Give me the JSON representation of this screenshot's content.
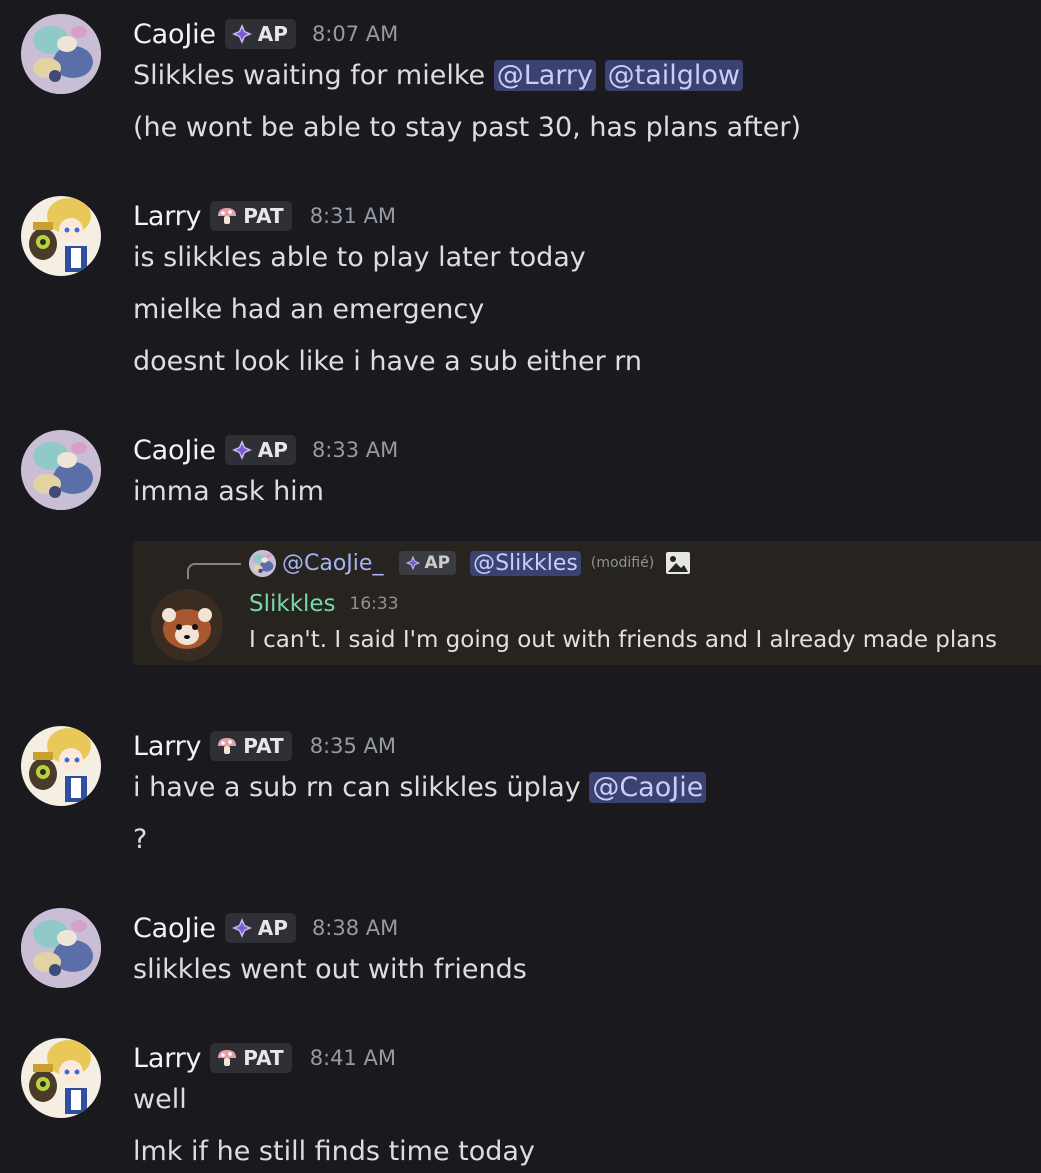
{
  "colors": {
    "background": "#1a1a1e",
    "mention_bg": "#3c4270",
    "mention_fg": "#c9cdfb",
    "quote_name": "#7ad7a9"
  },
  "tags": {
    "caojie": "AP",
    "larry": "PAT",
    "caojie_icon": "diamond-sparkle-icon",
    "larry_icon": "mushroom-icon"
  },
  "messages": [
    {
      "user": "CaoJie",
      "time": "8:07 AM",
      "line1_text": "Slikkles waiting for mielke ",
      "line1_mention1": "@Larry",
      "line1_mention2": "@tailglow",
      "line2": "(he wont be able to stay past 30, has plans after)"
    },
    {
      "user": "Larry",
      "time": "8:31 AM",
      "line1": "is slikkles able to play later today",
      "line2": "mielke had an emergency",
      "line3": "doesnt look like i have a sub either rn"
    },
    {
      "user": "CaoJie",
      "time": "8:33 AM",
      "line1": "imma ask him"
    },
    {
      "user": "Larry",
      "time": "8:35 AM",
      "line1_text": "i have a sub rn can slikkles üplay ",
      "line1_mention": "@CaoJie",
      "line2": "?"
    },
    {
      "user": "CaoJie",
      "time": "8:38 AM",
      "line1": "slikkles went out with friends"
    },
    {
      "user": "Larry",
      "time": "8:41 AM",
      "line1": "well",
      "line2": "lmk if he still finds time today"
    }
  ],
  "quote": {
    "reply_name": "@CaoJie_",
    "reply_tag": "AP",
    "reply_mention": "@Slikkles",
    "edited": "(modifié)",
    "image_icon": "image-icon",
    "author": "Slikkles",
    "time": "16:33",
    "text": "I can't. I said I'm going out with friends and I already made plans"
  }
}
